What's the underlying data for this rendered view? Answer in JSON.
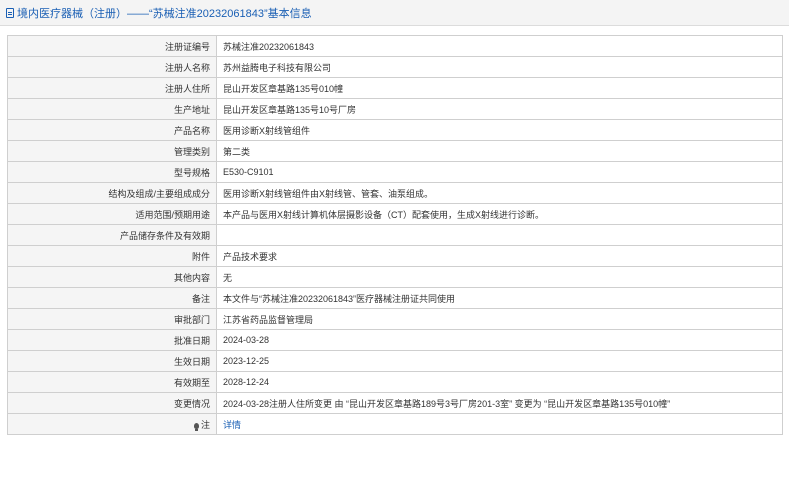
{
  "header": {
    "title": "境内医疗器械（注册）——“苏械注准20232061843”基本信息"
  },
  "rows": [
    {
      "label": "注册证编号",
      "value": "苏械注准20232061843"
    },
    {
      "label": "注册人名称",
      "value": "苏州益腾电子科技有限公司"
    },
    {
      "label": "注册人住所",
      "value": "昆山开发区章基路135号010幢"
    },
    {
      "label": "生产地址",
      "value": "昆山开发区章基路135号10号厂房"
    },
    {
      "label": "产品名称",
      "value": "医用诊断X射线管组件"
    },
    {
      "label": "管理类别",
      "value": "第二类"
    },
    {
      "label": "型号规格",
      "value": "E530-C9101"
    },
    {
      "label": "结构及组成/主要组成成分",
      "value": "医用诊断X射线管组件由X射线管、管套、油泵组成。"
    },
    {
      "label": "适用范围/预期用途",
      "value": "本产品与医用X射线计算机体层摄影设备（CT）配套使用，生成X射线进行诊断。"
    },
    {
      "label": "产品储存条件及有效期",
      "value": ""
    },
    {
      "label": "附件",
      "value": "产品技术要求"
    },
    {
      "label": "其他内容",
      "value": "无"
    },
    {
      "label": "备注",
      "value": "本文件与“苏械注准20232061843”医疗器械注册证共同使用"
    },
    {
      "label": "审批部门",
      "value": "江苏省药品监督管理局"
    },
    {
      "label": "批准日期",
      "value": "2024-03-28"
    },
    {
      "label": "生效日期",
      "value": "2023-12-25"
    },
    {
      "label": "有效期至",
      "value": "2028-12-24"
    },
    {
      "label": "变更情况",
      "value": "2024-03-28注册人住所变更 由 “昆山开发区章基路189号3号厂房201-3室” 变更为 “昆山开发区章基路135号010幢”"
    }
  ],
  "note": {
    "label": "注",
    "icon": "bulb-icon",
    "link": "详情",
    "link_color": "#1a5fb4"
  }
}
